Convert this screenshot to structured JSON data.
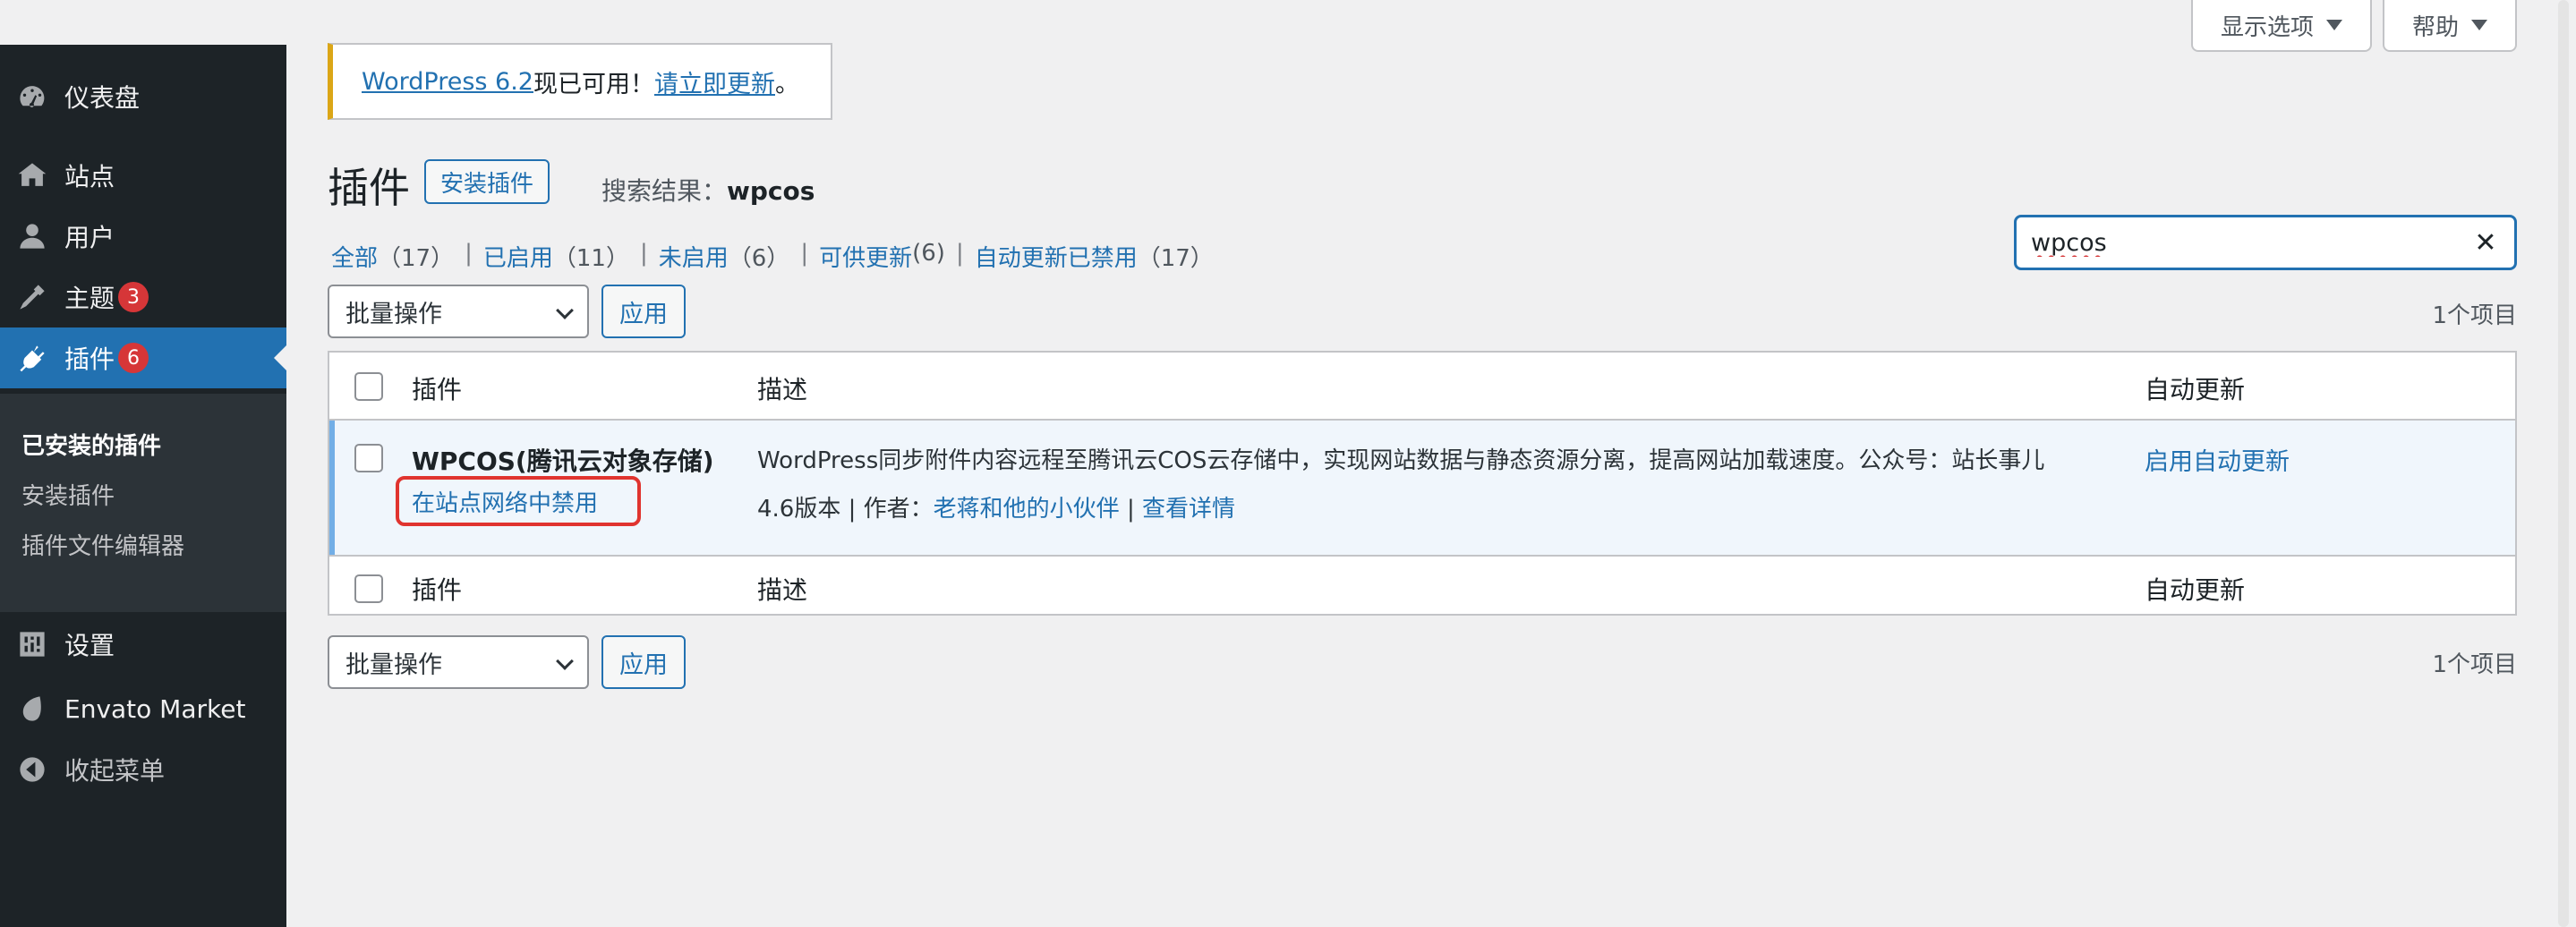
{
  "topbar": {
    "screen_options": "显示选项",
    "help": "帮助"
  },
  "sidebar": {
    "items": [
      {
        "label": "仪表盘",
        "icon": "dashboard-icon"
      },
      {
        "label": "站点",
        "icon": "sites-icon"
      },
      {
        "label": "用户",
        "icon": "users-icon"
      },
      {
        "label": "主题",
        "icon": "themes-icon",
        "badge": "3"
      },
      {
        "label": "插件",
        "icon": "plugins-icon",
        "badge": "6"
      },
      {
        "label": "设置",
        "icon": "settings-icon"
      },
      {
        "label": "Envato Market",
        "icon": "envato-icon"
      },
      {
        "label": "收起菜单",
        "icon": "collapse-icon"
      }
    ],
    "submenu": [
      "已安装的插件",
      "安装插件",
      "插件文件编辑器"
    ]
  },
  "notice": {
    "link1": "WordPress 6.2",
    "text": "现已可用！",
    "link2": "请立即更新",
    "end": "。"
  },
  "header": {
    "title": "插件",
    "add_new": "安装插件",
    "search_label": "搜索结果：",
    "search_term": "wpcos"
  },
  "filters": [
    {
      "label": "全部",
      "count": "（17）"
    },
    {
      "label": "已启用",
      "count": "（11）"
    },
    {
      "label": "未启用",
      "count": "（6）"
    },
    {
      "label": "可供更新",
      "count": "(6)"
    },
    {
      "label": "自动更新已禁用",
      "count": "（17）"
    }
  ],
  "search": {
    "value": "wpcos",
    "clear": "✕"
  },
  "bulk": {
    "label": "批量操作",
    "apply": "应用",
    "items": "1个项目"
  },
  "table": {
    "columns": [
      "插件",
      "描述",
      "自动更新"
    ],
    "rows": [
      {
        "name": "WPCOS(腾讯云对象存储)",
        "action": "在站点网络中禁用",
        "description": "WordPress同步附件内容远程至腾讯云COS云存储中，实现网站数据与静态资源分离，提高网站加载速度。公众号：站长事儿",
        "version": "4.6版本",
        "author_label": "作者：",
        "author": "老蒋和他的小伙伴",
        "details": "查看详情",
        "auto_update": "启用自动更新"
      }
    ]
  },
  "colors": {
    "sidebar": "#1d2327",
    "active": "#2271b1",
    "badge": "#d63638",
    "notice_border": "#dba617",
    "highlight": "#e0342f"
  }
}
